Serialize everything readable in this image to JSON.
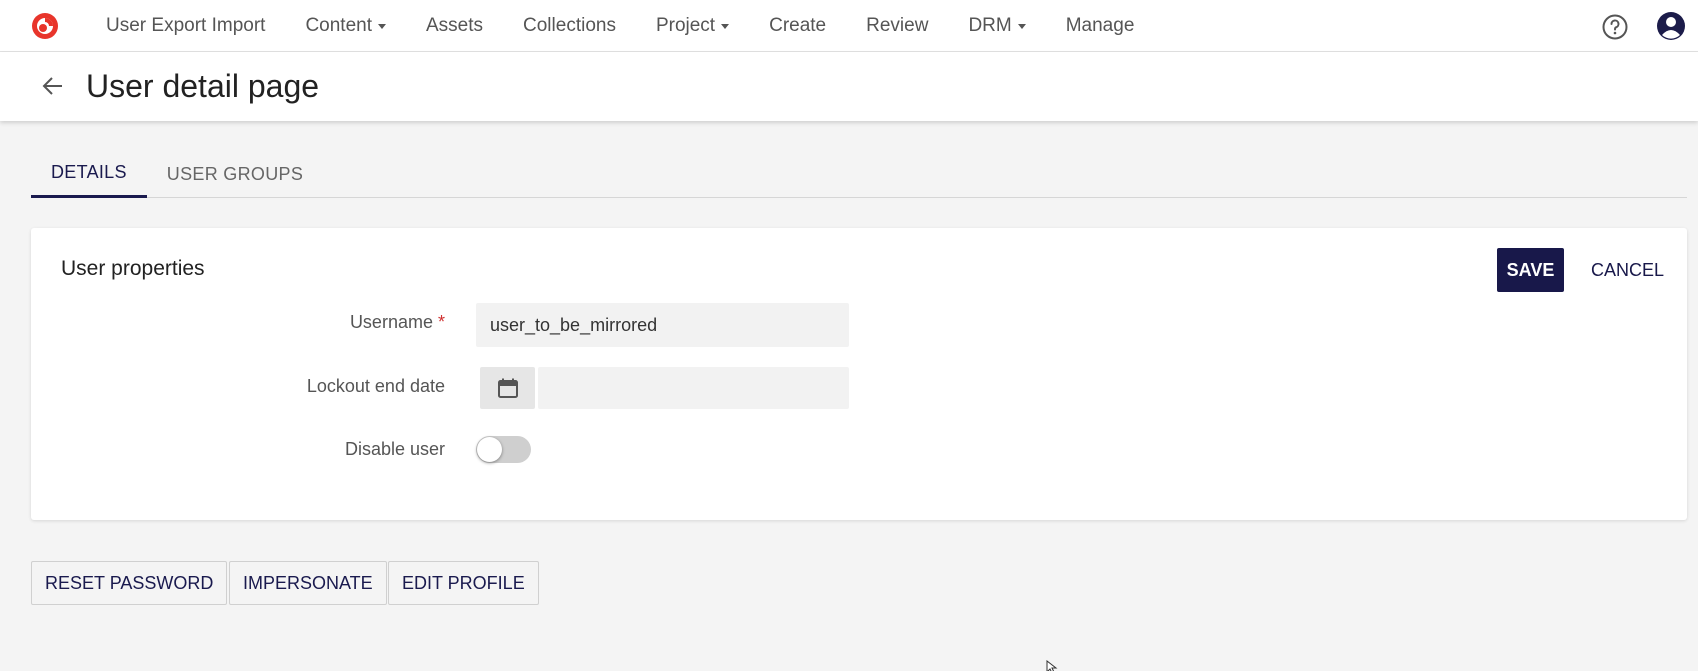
{
  "nav": {
    "items": [
      {
        "label": "User Export Import",
        "dropdown": false
      },
      {
        "label": "Content",
        "dropdown": true
      },
      {
        "label": "Assets",
        "dropdown": false
      },
      {
        "label": "Collections",
        "dropdown": false
      },
      {
        "label": "Project",
        "dropdown": true
      },
      {
        "label": "Create",
        "dropdown": false
      },
      {
        "label": "Review",
        "dropdown": false
      },
      {
        "label": "DRM",
        "dropdown": true
      },
      {
        "label": "Manage",
        "dropdown": false
      }
    ],
    "icons": {
      "logo": "app-logo",
      "help": "help-icon",
      "user": "user-avatar-icon"
    }
  },
  "header": {
    "title": "User detail page",
    "back_icon": "arrow-left-icon"
  },
  "tabs": [
    {
      "label": "DETAILS",
      "active": true
    },
    {
      "label": "USER GROUPS",
      "active": false
    }
  ],
  "card": {
    "title": "User properties",
    "save_label": "SAVE",
    "cancel_label": "CANCEL",
    "fields": {
      "username_label": "Username",
      "username_required_mark": "*",
      "username_value": "user_to_be_mirrored",
      "lockout_label": "Lockout end date",
      "lockout_value": "",
      "disable_label": "Disable user",
      "disable_value": false
    }
  },
  "actions": {
    "reset_password": "RESET PASSWORD",
    "impersonate": "IMPERSONATE",
    "edit_profile": "EDIT PROFILE"
  },
  "colors": {
    "primary": "#18184a",
    "logo": "#e8352b",
    "background": "#f4f4f4"
  }
}
